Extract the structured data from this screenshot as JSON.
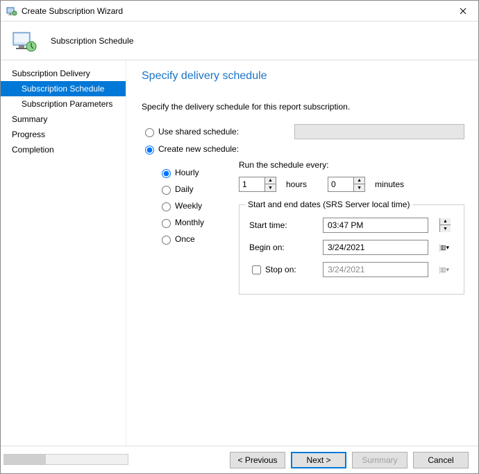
{
  "window": {
    "title": "Create Subscription Wizard"
  },
  "header": {
    "subtitle": "Subscription Schedule"
  },
  "sidebar": {
    "items": [
      {
        "label": "Subscription Delivery",
        "indent": false,
        "selected": false
      },
      {
        "label": "Subscription Schedule",
        "indent": true,
        "selected": true
      },
      {
        "label": "Subscription Parameters",
        "indent": true,
        "selected": false
      },
      {
        "label": "Summary",
        "indent": false,
        "selected": false
      },
      {
        "label": "Progress",
        "indent": false,
        "selected": false
      },
      {
        "label": "Completion",
        "indent": false,
        "selected": false
      }
    ]
  },
  "main": {
    "title": "Specify delivery schedule",
    "description": "Specify the delivery schedule for this report subscription.",
    "schedule_mode": {
      "shared_label": "Use shared schedule:",
      "create_label": "Create new schedule:",
      "selected": "create"
    },
    "frequency": {
      "options": [
        "Hourly",
        "Daily",
        "Weekly",
        "Monthly",
        "Once"
      ],
      "selected": "Hourly"
    },
    "run_every": {
      "label": "Run the schedule every:",
      "hours_value": "1",
      "hours_unit": "hours",
      "minutes_value": "0",
      "minutes_unit": "minutes"
    },
    "dates": {
      "legend": "Start and end dates (SRS Server local time)",
      "start_time_label": "Start time:",
      "start_time_value": "03:47 PM",
      "begin_label": "Begin on:",
      "begin_value": "3/24/2021",
      "stop_label": "Stop on:",
      "stop_value": "3/24/2021",
      "stop_checked": false
    }
  },
  "footer": {
    "previous": "< Previous",
    "next": "Next >",
    "summary": "Summary",
    "cancel": "Cancel"
  }
}
